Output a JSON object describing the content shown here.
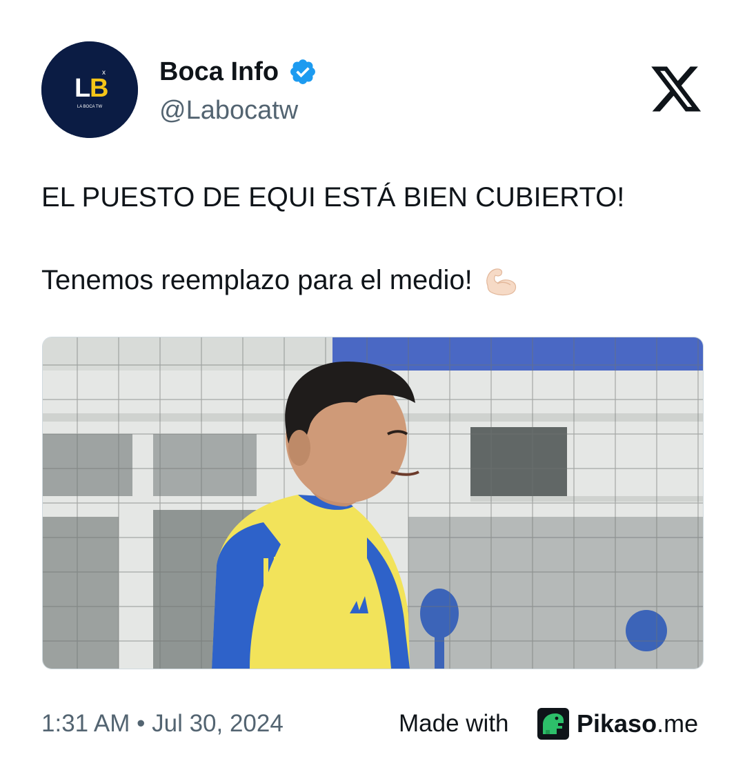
{
  "author": {
    "display_name": "Boca Info",
    "handle": "@Labocatw",
    "avatar": {
      "monogram": "LB",
      "caption": "LA BOCA TW",
      "background": "#0b1c44",
      "accent": "#f5c518"
    },
    "verified_icon": "verified-badge-icon",
    "verified_color": "#1d9bf0"
  },
  "platform_icon": "x-logo-icon",
  "tweet": {
    "line_1": "EL PUESTO DE EQUI ESTÁ BIEN CUBIERTO!",
    "line_2": "Tenemos reemplazo para el medio!",
    "line_2_emoji": "flexed-biceps-icon"
  },
  "media": {
    "type": "photo",
    "subject": "player-in-training-kit"
  },
  "footer": {
    "timestamp": "1:31 AM • Jul 30, 2024",
    "made_with": "Made with",
    "brand_bold": "Pikaso",
    "brand_suffix": ".me",
    "brand_icon": "pikaso-dino-icon",
    "brand_color": "#2dbf6a"
  },
  "colors": {
    "text": "#0f1419",
    "secondary_text": "#536471",
    "border": "#cfd9de"
  }
}
